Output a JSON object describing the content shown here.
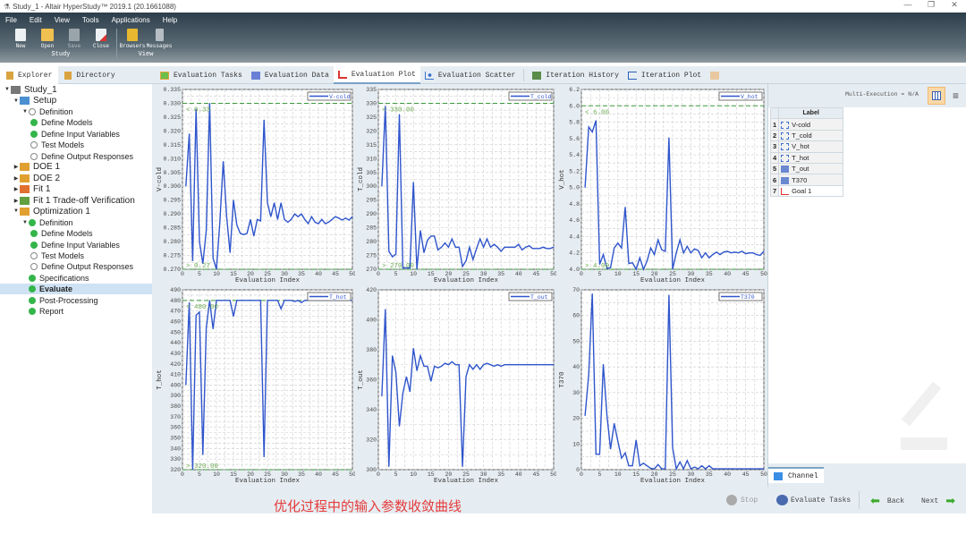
{
  "window": {
    "title": "Study_1 - Altair HyperStudy™ 2019.1 (20.1661088)",
    "controls": [
      "—",
      "❐",
      "✕"
    ]
  },
  "menu": [
    "File",
    "Edit",
    "View",
    "Tools",
    "Applications",
    "Help"
  ],
  "ribbon": {
    "groups": [
      {
        "name": "Study",
        "buttons": [
          "New",
          "Open",
          "Save",
          "Close"
        ]
      },
      {
        "name": "View",
        "buttons": [
          "Browsers",
          "Messages"
        ]
      }
    ]
  },
  "left_tabs": [
    "Explorer",
    "Directory"
  ],
  "main_tabs": [
    "Evaluation Tasks",
    "Evaluation Data",
    "Evaluation Plot",
    "Evaluation Scatter",
    "Iteration History",
    "Iteration Plot"
  ],
  "tree": [
    {
      "label": "Study_1",
      "level": 0,
      "arrow": "▼",
      "icon": "study"
    },
    {
      "label": "Setup",
      "level": 1,
      "arrow": "▼",
      "icon": "setup"
    },
    {
      "label": "Definition",
      "level": 2,
      "arrow": "▼",
      "icon": "gray"
    },
    {
      "label": "Define Models",
      "level": 3,
      "icon": "ok"
    },
    {
      "label": "Define Input Variables",
      "level": 3,
      "icon": "ok"
    },
    {
      "label": "Test Models",
      "level": 3,
      "icon": "gray"
    },
    {
      "label": "Define Output Responses",
      "level": 3,
      "icon": "gray"
    },
    {
      "label": "DOE 1",
      "level": 1,
      "arrow": "▶",
      "icon": "doe"
    },
    {
      "label": "DOE 2",
      "level": 1,
      "arrow": "▶",
      "icon": "doe"
    },
    {
      "label": "Fit 1",
      "level": 1,
      "arrow": "▶",
      "icon": "fit"
    },
    {
      "label": "Fit 1 Trade-off Verification",
      "level": 1,
      "arrow": "▶",
      "icon": "fit2"
    },
    {
      "label": "Optimization 1",
      "level": 1,
      "arrow": "▼",
      "icon": "opt"
    },
    {
      "label": "Definition",
      "level": 2,
      "arrow": "▼",
      "icon": "ok"
    },
    {
      "label": "Define Models",
      "level": 3,
      "icon": "ok"
    },
    {
      "label": "Define Input Variables",
      "level": 3,
      "icon": "ok"
    },
    {
      "label": "Test Models",
      "level": 3,
      "icon": "gray"
    },
    {
      "label": "Define Output Responses",
      "level": 3,
      "icon": "gray"
    },
    {
      "label": "Specifications",
      "level": 2,
      "icon": "ok"
    },
    {
      "label": "Evaluate",
      "level": 2,
      "icon": "ok",
      "selected": true
    },
    {
      "label": "Post-Processing",
      "level": 2,
      "icon": "ok"
    },
    {
      "label": "Report",
      "level": 2,
      "icon": "ok"
    }
  ],
  "right_panel": {
    "multi_execution": "Multi-Execution = N/A",
    "label_header": "Label",
    "labels": [
      {
        "n": "1",
        "label": "V-cold",
        "type": "input"
      },
      {
        "n": "2",
        "label": "T_cold",
        "type": "input"
      },
      {
        "n": "3",
        "label": "V_hot",
        "type": "input"
      },
      {
        "n": "4",
        "label": "T_hot",
        "type": "input"
      },
      {
        "n": "5",
        "label": "T_out",
        "type": "output"
      },
      {
        "n": "6",
        "label": "T370",
        "type": "output"
      },
      {
        "n": "7",
        "label": "Goal 1",
        "type": "goal"
      }
    ],
    "channel_tab": "Channel"
  },
  "bottom": {
    "caption": "优化过程中的输入参数收敛曲线",
    "stop": "Stop",
    "evaluate_tasks": "Evaluate Tasks",
    "back": "Back",
    "next": "Next"
  },
  "colors": {
    "series": "#2f55cc",
    "bound": "#3a9a3a",
    "caption": "#e53b3b"
  },
  "chart_data": [
    {
      "type": "line",
      "title": "",
      "legend": "V-cold",
      "xlabel": "Evaluation Index",
      "ylabel": "V-cold",
      "xlim": [
        0,
        50
      ],
      "ylim": [
        0.27,
        0.335
      ],
      "xticks": [
        0,
        5,
        10,
        15,
        20,
        25,
        30,
        35,
        40,
        45,
        50
      ],
      "yticks": [
        0.27,
        0.275,
        0.28,
        0.285,
        0.29,
        0.295,
        0.3,
        0.305,
        0.31,
        0.315,
        0.32,
        0.325,
        0.33,
        0.335
      ],
      "ytick_labels": [
        "0.270",
        "0.275",
        "0.280",
        "0.285",
        "0.290",
        "0.295",
        "0.300",
        "0.305",
        "0.310",
        "0.315",
        "0.320",
        "0.325",
        "0.330",
        "0.335"
      ],
      "upper_bound": 0.33,
      "upper_label": "< 0.33",
      "lower_bound": 0.27,
      "lower_label": "> 0.27",
      "x": [
        1,
        2,
        3,
        4,
        5,
        6,
        7,
        8,
        9,
        10,
        11,
        12,
        13,
        14,
        15,
        16,
        17,
        18,
        19,
        20,
        21,
        22,
        23,
        24,
        25,
        26,
        27,
        28,
        29,
        30,
        31,
        32,
        33,
        34,
        35,
        36,
        37,
        38,
        39,
        40,
        41,
        42,
        43,
        44,
        45,
        46,
        47,
        48,
        49,
        50
      ],
      "y": [
        0.3,
        0.319,
        0.273,
        0.328,
        0.28,
        0.272,
        0.284,
        0.33,
        0.274,
        0.27,
        0.287,
        0.309,
        0.289,
        0.276,
        0.295,
        0.286,
        0.283,
        0.2825,
        0.283,
        0.288,
        0.282,
        0.288,
        0.2875,
        0.324,
        0.294,
        0.289,
        0.294,
        0.288,
        0.294,
        0.288,
        0.287,
        0.288,
        0.29,
        0.289,
        0.29,
        0.288,
        0.2865,
        0.289,
        0.287,
        0.2865,
        0.288,
        0.2865,
        0.287,
        0.288,
        0.289,
        0.2885,
        0.2878,
        0.2885,
        0.2878,
        0.289
      ]
    },
    {
      "type": "line",
      "title": "",
      "legend": "T_cold",
      "xlabel": "Evaluation Index",
      "ylabel": "T_cold",
      "xlim": [
        0,
        50
      ],
      "ylim": [
        270,
        335
      ],
      "xticks": [
        0,
        5,
        10,
        15,
        20,
        25,
        30,
        35,
        40,
        45,
        50
      ],
      "yticks": [
        270,
        275,
        280,
        285,
        290,
        295,
        300,
        305,
        310,
        315,
        320,
        325,
        330,
        335
      ],
      "ytick_labels": [
        "270",
        "275",
        "280",
        "285",
        "290",
        "295",
        "300",
        "305",
        "310",
        "315",
        "320",
        "325",
        "330",
        "335"
      ],
      "upper_bound": 330,
      "upper_label": "< 330.00",
      "lower_bound": 270,
      "lower_label": "> 270.00",
      "x": [
        1,
        2,
        3,
        4,
        5,
        6,
        7,
        8,
        9,
        10,
        11,
        12,
        13,
        14,
        15,
        16,
        17,
        18,
        19,
        20,
        21,
        22,
        23,
        24,
        25,
        26,
        27,
        28,
        29,
        30,
        31,
        32,
        33,
        34,
        35,
        36,
        37,
        38,
        39,
        40,
        41,
        42,
        43,
        44,
        45,
        46,
        47,
        48,
        49,
        50
      ],
      "y": [
        300,
        329,
        276.5,
        274.5,
        275.5,
        326,
        270.5,
        270.5,
        270.5,
        301.5,
        270,
        284,
        276,
        280.5,
        282,
        282,
        277,
        278,
        279.5,
        278,
        281,
        278,
        278,
        271,
        273,
        278,
        273.5,
        277.5,
        281,
        278,
        281,
        278,
        279,
        278,
        276.5,
        278,
        278,
        278,
        278,
        279,
        277,
        278,
        278.5,
        277.5,
        277.5,
        277.5,
        278,
        277.5,
        277.5,
        278
      ]
    },
    {
      "type": "line",
      "title": "",
      "legend": "V_hot",
      "xlabel": "Evaluation Index",
      "ylabel": "V_hot",
      "xlim": [
        0,
        50
      ],
      "ylim": [
        4.0,
        6.2
      ],
      "xticks": [
        0,
        5,
        10,
        15,
        20,
        25,
        30,
        35,
        40,
        45,
        50
      ],
      "yticks": [
        4.0,
        4.2,
        4.4,
        4.6,
        4.8,
        5.0,
        5.2,
        5.4,
        5.6,
        5.8,
        6.0,
        6.2
      ],
      "ytick_labels": [
        "4.0",
        "4.2",
        "4.4",
        "4.6",
        "4.8",
        "5.0",
        "5.2",
        "5.4",
        "5.6",
        "5.8",
        "6.0",
        "6.2"
      ],
      "upper_bound": 6.0,
      "upper_label": "< 6.00",
      "lower_bound": 4.0,
      "lower_label": "> 4.00",
      "x": [
        1,
        2,
        3,
        4,
        5,
        6,
        7,
        8,
        9,
        10,
        11,
        12,
        13,
        14,
        15,
        16,
        17,
        18,
        19,
        20,
        21,
        22,
        23,
        24,
        25,
        26,
        27,
        28,
        29,
        30,
        31,
        32,
        33,
        34,
        35,
        36,
        37,
        38,
        39,
        40,
        41,
        42,
        43,
        44,
        45,
        46,
        47,
        48,
        49,
        50
      ],
      "y": [
        5.0,
        5.74,
        5.68,
        5.82,
        4.06,
        4.18,
        4.01,
        4.02,
        4.26,
        4.32,
        4.26,
        4.76,
        4.07,
        4.08,
        4.0,
        4.14,
        4.0,
        4.1,
        4.26,
        4.18,
        4.36,
        4.24,
        4.22,
        5.61,
        4.0,
        4.2,
        4.36,
        4.2,
        4.28,
        4.2,
        4.25,
        4.23,
        4.14,
        4.2,
        4.14,
        4.18,
        4.21,
        4.18,
        4.21,
        4.22,
        4.2,
        4.21,
        4.2,
        4.22,
        4.19,
        4.2,
        4.2,
        4.18,
        4.17,
        4.22
      ]
    },
    {
      "type": "line",
      "title": "",
      "legend": "T_hot",
      "xlabel": "Evaluation Index",
      "ylabel": "T_hot",
      "xlim": [
        0,
        50
      ],
      "ylim": [
        320,
        490
      ],
      "xticks": [
        0,
        5,
        10,
        15,
        20,
        25,
        30,
        35,
        40,
        45,
        50
      ],
      "yticks": [
        320,
        330,
        340,
        350,
        360,
        370,
        380,
        390,
        400,
        410,
        420,
        430,
        440,
        450,
        460,
        470,
        480,
        490
      ],
      "ytick_labels": [
        "320",
        "330",
        "340",
        "350",
        "360",
        "370",
        "380",
        "390",
        "400",
        "410",
        "420",
        "430",
        "440",
        "450",
        "460",
        "470",
        "480",
        "490"
      ],
      "upper_bound": 480,
      "upper_label": "< 480.00",
      "lower_bound": 320,
      "lower_label": "> 320.00",
      "x": [
        1,
        2,
        3,
        4,
        5,
        6,
        7,
        8,
        9,
        10,
        11,
        12,
        13,
        14,
        15,
        16,
        17,
        18,
        19,
        20,
        21,
        22,
        23,
        24,
        25,
        26,
        27,
        28,
        29,
        30,
        31,
        32,
        33,
        34,
        35,
        36,
        37,
        38,
        39,
        40,
        41,
        42,
        43,
        44,
        45,
        46,
        47,
        48,
        49,
        50
      ],
      "y": [
        400,
        478,
        320,
        466,
        469,
        334,
        454,
        480,
        453,
        480,
        480,
        480,
        480,
        480,
        465,
        480,
        480,
        480,
        480,
        480,
        480,
        480,
        480,
        332,
        480,
        480,
        480,
        480,
        472,
        480,
        480,
        480,
        479,
        480,
        478,
        480,
        480,
        480,
        480,
        480,
        480,
        480,
        480,
        480,
        480,
        480,
        480,
        480,
        480,
        480
      ]
    },
    {
      "type": "line",
      "title": "",
      "legend": "T_out",
      "xlabel": "Evaluation Index",
      "ylabel": "T_out",
      "xlim": [
        0,
        50
      ],
      "ylim": [
        300,
        420
      ],
      "xticks": [
        0,
        5,
        10,
        15,
        20,
        25,
        30,
        35,
        40,
        45,
        50
      ],
      "yticks": [
        300,
        320,
        340,
        360,
        380,
        400,
        420
      ],
      "ytick_labels": [
        "300",
        "320",
        "340",
        "360",
        "380",
        "400",
        "420"
      ],
      "x": [
        1,
        2,
        3,
        4,
        5,
        6,
        7,
        8,
        9,
        10,
        11,
        12,
        13,
        14,
        15,
        16,
        17,
        18,
        19,
        20,
        21,
        22,
        23,
        24,
        25,
        26,
        27,
        28,
        29,
        30,
        31,
        32,
        33,
        34,
        35,
        36,
        37,
        38,
        39,
        40,
        41,
        42,
        43,
        44,
        45,
        46,
        47,
        48,
        49,
        50
      ],
      "y": [
        349,
        407,
        302,
        376,
        365,
        329,
        351,
        362,
        352,
        381,
        366,
        376,
        369,
        369,
        359,
        369,
        368,
        369,
        371,
        370,
        372,
        370,
        370,
        302,
        362,
        370,
        367,
        370,
        367,
        370,
        371,
        370,
        369,
        370,
        369,
        370,
        370,
        370,
        370,
        370,
        370,
        370,
        370,
        370,
        370,
        370,
        370,
        370,
        370,
        370
      ]
    },
    {
      "type": "line",
      "title": "",
      "legend": "T370",
      "xlabel": "Evaluation Index",
      "ylabel": "T370",
      "xlim": [
        0,
        50
      ],
      "ylim": [
        0,
        70
      ],
      "xticks": [
        0,
        5,
        10,
        15,
        20,
        25,
        30,
        35,
        40,
        45,
        50
      ],
      "yticks": [
        0,
        10,
        20,
        30,
        40,
        50,
        60,
        70
      ],
      "ytick_labels": [
        "0",
        "10",
        "20",
        "30",
        "40",
        "50",
        "60",
        "70"
      ],
      "x": [
        1,
        2,
        3,
        4,
        5,
        6,
        7,
        8,
        9,
        10,
        11,
        12,
        13,
        14,
        15,
        16,
        17,
        18,
        19,
        20,
        21,
        22,
        23,
        24,
        25,
        26,
        27,
        28,
        29,
        30,
        31,
        32,
        33,
        34,
        35,
        36,
        37,
        38,
        39,
        40,
        41,
        42,
        43,
        44,
        45,
        46,
        47,
        48,
        49,
        50
      ],
      "y": [
        21,
        37,
        68.5,
        6,
        6,
        41,
        21,
        8,
        18,
        11,
        4.5,
        6.5,
        1.5,
        1.5,
        11.5,
        1.5,
        2.5,
        1.5,
        0.5,
        0.3,
        2,
        0.3,
        0.3,
        68,
        8.5,
        0.3,
        3,
        0.3,
        3.5,
        0.3,
        1,
        0.3,
        1.5,
        0.3,
        1.5,
        0.3,
        0.3,
        0.3,
        0.3,
        0.3,
        0.3,
        0.3,
        0.3,
        0.3,
        0.3,
        0.3,
        0.3,
        0.3,
        0.3,
        0.3
      ]
    }
  ]
}
